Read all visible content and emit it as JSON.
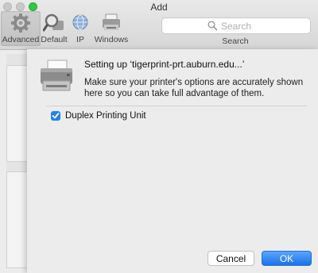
{
  "window": {
    "title": "Add"
  },
  "toolbar": {
    "items": [
      {
        "label": "Advanced",
        "icon": "gear-icon",
        "selected": true
      },
      {
        "label": "Default",
        "icon": "magnifier-icon"
      },
      {
        "label": "IP",
        "icon": "globe-icon"
      },
      {
        "label": "Windows",
        "icon": "windows-printer-icon"
      }
    ],
    "search": {
      "placeholder": "Search",
      "label": "Search"
    }
  },
  "sheet": {
    "title": "Setting up ‘tigerprint-prt.auburn.edu...’",
    "message": "Make sure your printer's options are accurately shown here so you can take full advantage of them.",
    "option": {
      "label": "Duplex Printing Unit",
      "checked": true
    },
    "buttons": {
      "cancel": "Cancel",
      "ok": "OK"
    }
  },
  "colors": {
    "accent": "#1a73ea",
    "zoom": "#35c649"
  }
}
